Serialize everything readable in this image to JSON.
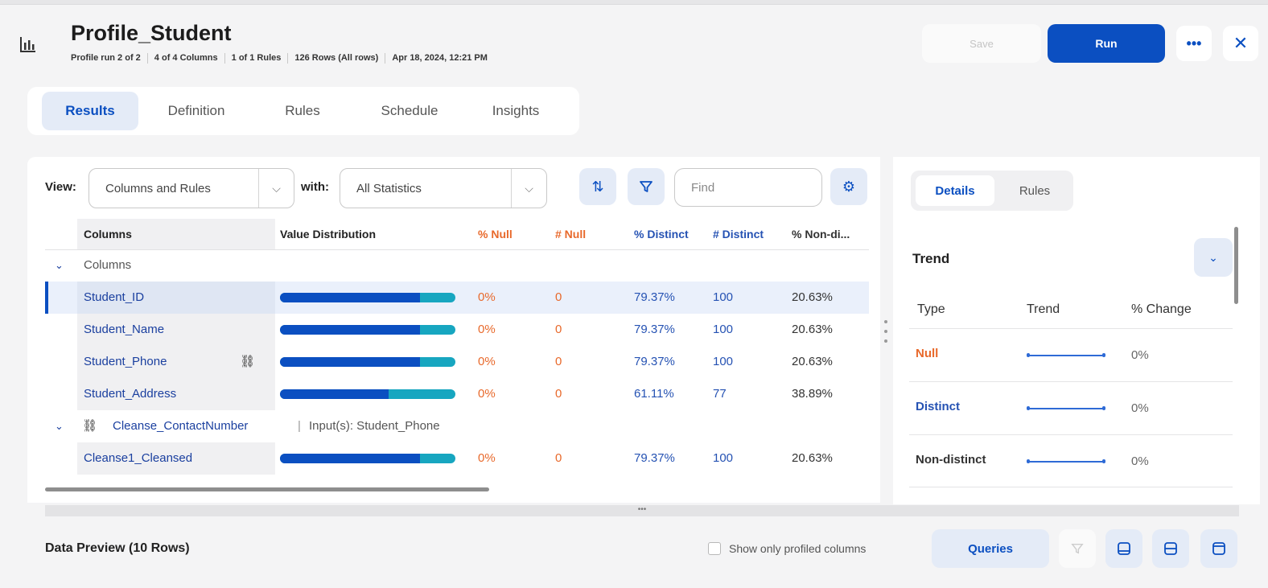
{
  "header": {
    "title": "Profile_Student",
    "meta": [
      "Profile run 2 of 2",
      "4 of 4 Columns",
      "1 of 1 Rules",
      "126 Rows (All rows)",
      "Apr 18, 2024, 12:21 PM"
    ],
    "save_label": "Save",
    "run_label": "Run",
    "more_label": "•••",
    "close_label": "✕"
  },
  "tabs": [
    "Results",
    "Definition",
    "Rules",
    "Schedule",
    "Insights"
  ],
  "toolbar": {
    "view_label": "View:",
    "view_value": "Columns and Rules",
    "with_label": "with:",
    "with_value": "All Statistics",
    "find_placeholder": "Find"
  },
  "grid": {
    "headers": [
      "Columns",
      "Value Distribution",
      "% Null",
      "# Null",
      "% Distinct",
      "# Distinct",
      "% Non-di..."
    ],
    "group_label": "Columns",
    "rows": [
      {
        "name": "Student_ID",
        "pnull": "0%",
        "nnull": "0",
        "pdistinct": "79.37%",
        "ndistinct": "100",
        "pnondistinct": "20.63%",
        "distinct_ratio": 0.79
      },
      {
        "name": "Student_Name",
        "pnull": "0%",
        "nnull": "0",
        "pdistinct": "79.37%",
        "ndistinct": "100",
        "pnondistinct": "20.63%",
        "distinct_ratio": 0.79
      },
      {
        "name": "Student_Phone",
        "pnull": "0%",
        "nnull": "0",
        "pdistinct": "79.37%",
        "ndistinct": "100",
        "pnondistinct": "20.63%",
        "distinct_ratio": 0.79
      },
      {
        "name": "Student_Address",
        "pnull": "0%",
        "nnull": "0",
        "pdistinct": "61.11%",
        "ndistinct": "77",
        "pnondistinct": "38.89%",
        "distinct_ratio": 0.61
      }
    ],
    "rule_group": {
      "name": "Cleanse_ContactNumber",
      "inputs": "Input(s): Student_Phone"
    },
    "rule_row": {
      "name": "Cleanse1_Cleansed",
      "pnull": "0%",
      "nnull": "0",
      "pdistinct": "79.37%",
      "ndistinct": "100",
      "pnondistinct": "20.63%",
      "distinct_ratio": 0.79
    }
  },
  "data_preview": {
    "title": "Data Preview (10 Rows)",
    "show_profiled_label": "Show only profiled columns",
    "queries_label": "Queries"
  },
  "right_panel": {
    "tabs": [
      "Details",
      "Rules"
    ],
    "trend_title": "Trend",
    "headers": [
      "Type",
      "Trend",
      "% Change"
    ],
    "rows": [
      {
        "type": "Null",
        "change": "0%",
        "color": "#e8692b"
      },
      {
        "type": "Distinct",
        "change": "0%",
        "color": "#2552b3"
      },
      {
        "type": "Non-distinct",
        "change": "0%",
        "color": "#333333"
      }
    ]
  },
  "colors": {
    "accent": "#0b4fc1",
    "bar_distinct": "#0b4fc1",
    "bar_nondistinct": "#17a6c0",
    "null_orange": "#e8692b"
  }
}
